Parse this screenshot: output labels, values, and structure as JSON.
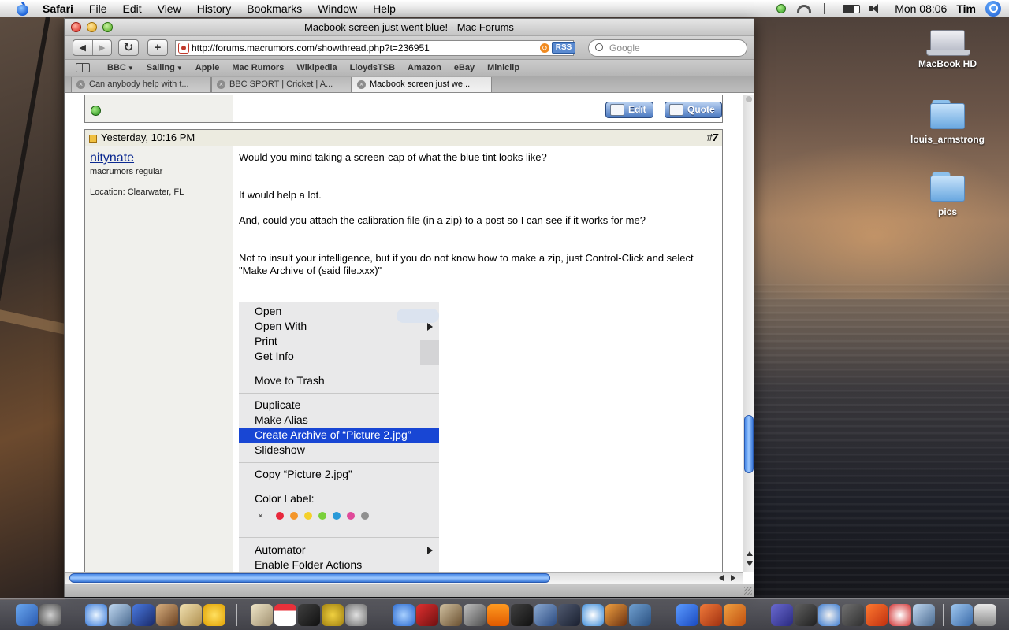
{
  "menubar": {
    "app_name": "Safari",
    "items": [
      "File",
      "Edit",
      "View",
      "History",
      "Bookmarks",
      "Window",
      "Help"
    ],
    "clock": "Mon 08:06",
    "user": "Tim"
  },
  "desktop": {
    "icons": [
      {
        "label": "MacBook HD",
        "icon": "hard-drive-icon"
      },
      {
        "label": "louis_armstrong",
        "icon": "folder-icon"
      },
      {
        "label": "pics",
        "icon": "folder-icon"
      }
    ]
  },
  "window": {
    "title": "Macbook screen just went blue! - Mac Forums",
    "url": "http://forums.macrumors.com/showthread.php?t=236951",
    "rss_label": "RSS",
    "search_placeholder": "Google",
    "bookmarks": [
      {
        "label": "BBC",
        "has_menu": true
      },
      {
        "label": "Sailing",
        "has_menu": true
      },
      {
        "label": "Apple",
        "has_menu": false
      },
      {
        "label": "Mac Rumors",
        "has_menu": false
      },
      {
        "label": "Wikipedia",
        "has_menu": false
      },
      {
        "label": "LloydsTSB",
        "has_menu": false
      },
      {
        "label": "Amazon",
        "has_menu": false
      },
      {
        "label": "eBay",
        "has_menu": false
      },
      {
        "label": "Miniclip",
        "has_menu": false
      }
    ],
    "tabs": [
      {
        "label": "Can anybody help with t...",
        "active": false
      },
      {
        "label": "BBC SPORT | Cricket | A...",
        "active": false
      },
      {
        "label": "Macbook screen just we...",
        "active": true
      }
    ]
  },
  "page": {
    "prev_post": {
      "edit_label": "Edit",
      "quote_label": "Quote"
    },
    "post": {
      "date": "Yesterday, 10:16 PM",
      "number_prefix": "#",
      "number": "7",
      "username": "nitynate",
      "user_title": "macrumors regular",
      "location": "Location: Clearwater, FL",
      "paragraphs": [
        "Would you mind taking a screen-cap of what the blue tint looks like?",
        "It would help a lot.",
        "And, could you attach the calibration file (in a zip) to a post so I can see if it works for me?",
        "Not to insult your intelligence, but if you do not know how to make a zip, just Control-Click and select \"Make Archive of (said file.xxx)\""
      ],
      "context_menu": {
        "items": [
          "Open",
          "Open With",
          "Print",
          "Get Info",
          "Move to Trash",
          "Duplicate",
          "Make Alias",
          "Create Archive of “Picture 2.jpg”",
          "Slideshow",
          "Copy “Picture 2.jpg”",
          "Color Label:",
          "Automator",
          "Enable Folder Actions"
        ],
        "highlighted": "Create Archive of “Picture 2.jpg”",
        "color_label_none": "×",
        "label_colors": [
          "#e8283c",
          "#f4962a",
          "#f4d02a",
          "#7ad03a",
          "#2a9ad8",
          "#e04a9a",
          "#909090"
        ]
      }
    }
  }
}
